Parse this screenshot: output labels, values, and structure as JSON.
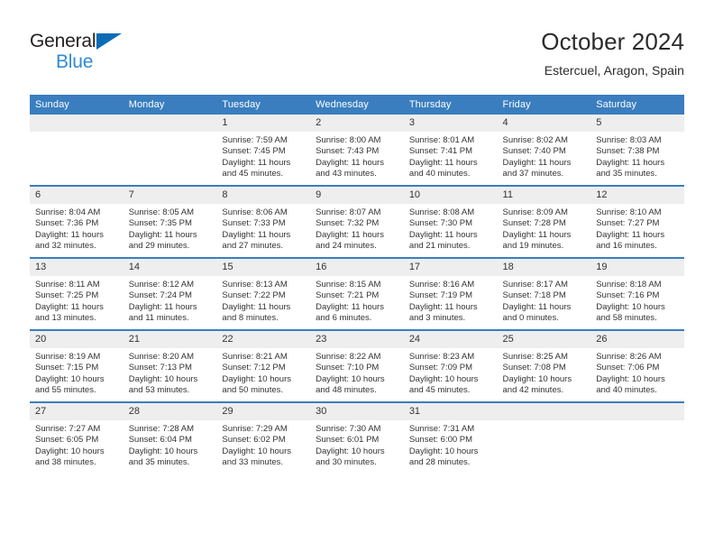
{
  "brand": {
    "name_top": "General",
    "name_bottom": "Blue",
    "triangle_color": "#0b6cb5",
    "text_color": "#231f20",
    "accent_color": "#2e8bd4"
  },
  "header": {
    "month_title": "October 2024",
    "location": "Estercuel, Aragon, Spain"
  },
  "theme": {
    "header_band": "#3a7ebf",
    "daynum_band": "#eeeeee",
    "text": "#333333"
  },
  "calendar": {
    "weekday_headers": [
      "Sunday",
      "Monday",
      "Tuesday",
      "Wednesday",
      "Thursday",
      "Friday",
      "Saturday"
    ],
    "weeks": [
      [
        {
          "day": "",
          "sunrise": "",
          "sunset": "",
          "daylight_line1": "",
          "daylight_line2": ""
        },
        {
          "day": "",
          "sunrise": "",
          "sunset": "",
          "daylight_line1": "",
          "daylight_line2": ""
        },
        {
          "day": "1",
          "sunrise": "Sunrise: 7:59 AM",
          "sunset": "Sunset: 7:45 PM",
          "daylight_line1": "Daylight: 11 hours",
          "daylight_line2": "and 45 minutes."
        },
        {
          "day": "2",
          "sunrise": "Sunrise: 8:00 AM",
          "sunset": "Sunset: 7:43 PM",
          "daylight_line1": "Daylight: 11 hours",
          "daylight_line2": "and 43 minutes."
        },
        {
          "day": "3",
          "sunrise": "Sunrise: 8:01 AM",
          "sunset": "Sunset: 7:41 PM",
          "daylight_line1": "Daylight: 11 hours",
          "daylight_line2": "and 40 minutes."
        },
        {
          "day": "4",
          "sunrise": "Sunrise: 8:02 AM",
          "sunset": "Sunset: 7:40 PM",
          "daylight_line1": "Daylight: 11 hours",
          "daylight_line2": "and 37 minutes."
        },
        {
          "day": "5",
          "sunrise": "Sunrise: 8:03 AM",
          "sunset": "Sunset: 7:38 PM",
          "daylight_line1": "Daylight: 11 hours",
          "daylight_line2": "and 35 minutes."
        }
      ],
      [
        {
          "day": "6",
          "sunrise": "Sunrise: 8:04 AM",
          "sunset": "Sunset: 7:36 PM",
          "daylight_line1": "Daylight: 11 hours",
          "daylight_line2": "and 32 minutes."
        },
        {
          "day": "7",
          "sunrise": "Sunrise: 8:05 AM",
          "sunset": "Sunset: 7:35 PM",
          "daylight_line1": "Daylight: 11 hours",
          "daylight_line2": "and 29 minutes."
        },
        {
          "day": "8",
          "sunrise": "Sunrise: 8:06 AM",
          "sunset": "Sunset: 7:33 PM",
          "daylight_line1": "Daylight: 11 hours",
          "daylight_line2": "and 27 minutes."
        },
        {
          "day": "9",
          "sunrise": "Sunrise: 8:07 AM",
          "sunset": "Sunset: 7:32 PM",
          "daylight_line1": "Daylight: 11 hours",
          "daylight_line2": "and 24 minutes."
        },
        {
          "day": "10",
          "sunrise": "Sunrise: 8:08 AM",
          "sunset": "Sunset: 7:30 PM",
          "daylight_line1": "Daylight: 11 hours",
          "daylight_line2": "and 21 minutes."
        },
        {
          "day": "11",
          "sunrise": "Sunrise: 8:09 AM",
          "sunset": "Sunset: 7:28 PM",
          "daylight_line1": "Daylight: 11 hours",
          "daylight_line2": "and 19 minutes."
        },
        {
          "day": "12",
          "sunrise": "Sunrise: 8:10 AM",
          "sunset": "Sunset: 7:27 PM",
          "daylight_line1": "Daylight: 11 hours",
          "daylight_line2": "and 16 minutes."
        }
      ],
      [
        {
          "day": "13",
          "sunrise": "Sunrise: 8:11 AM",
          "sunset": "Sunset: 7:25 PM",
          "daylight_line1": "Daylight: 11 hours",
          "daylight_line2": "and 13 minutes."
        },
        {
          "day": "14",
          "sunrise": "Sunrise: 8:12 AM",
          "sunset": "Sunset: 7:24 PM",
          "daylight_line1": "Daylight: 11 hours",
          "daylight_line2": "and 11 minutes."
        },
        {
          "day": "15",
          "sunrise": "Sunrise: 8:13 AM",
          "sunset": "Sunset: 7:22 PM",
          "daylight_line1": "Daylight: 11 hours",
          "daylight_line2": "and 8 minutes."
        },
        {
          "day": "16",
          "sunrise": "Sunrise: 8:15 AM",
          "sunset": "Sunset: 7:21 PM",
          "daylight_line1": "Daylight: 11 hours",
          "daylight_line2": "and 6 minutes."
        },
        {
          "day": "17",
          "sunrise": "Sunrise: 8:16 AM",
          "sunset": "Sunset: 7:19 PM",
          "daylight_line1": "Daylight: 11 hours",
          "daylight_line2": "and 3 minutes."
        },
        {
          "day": "18",
          "sunrise": "Sunrise: 8:17 AM",
          "sunset": "Sunset: 7:18 PM",
          "daylight_line1": "Daylight: 11 hours",
          "daylight_line2": "and 0 minutes."
        },
        {
          "day": "19",
          "sunrise": "Sunrise: 8:18 AM",
          "sunset": "Sunset: 7:16 PM",
          "daylight_line1": "Daylight: 10 hours",
          "daylight_line2": "and 58 minutes."
        }
      ],
      [
        {
          "day": "20",
          "sunrise": "Sunrise: 8:19 AM",
          "sunset": "Sunset: 7:15 PM",
          "daylight_line1": "Daylight: 10 hours",
          "daylight_line2": "and 55 minutes."
        },
        {
          "day": "21",
          "sunrise": "Sunrise: 8:20 AM",
          "sunset": "Sunset: 7:13 PM",
          "daylight_line1": "Daylight: 10 hours",
          "daylight_line2": "and 53 minutes."
        },
        {
          "day": "22",
          "sunrise": "Sunrise: 8:21 AM",
          "sunset": "Sunset: 7:12 PM",
          "daylight_line1": "Daylight: 10 hours",
          "daylight_line2": "and 50 minutes."
        },
        {
          "day": "23",
          "sunrise": "Sunrise: 8:22 AM",
          "sunset": "Sunset: 7:10 PM",
          "daylight_line1": "Daylight: 10 hours",
          "daylight_line2": "and 48 minutes."
        },
        {
          "day": "24",
          "sunrise": "Sunrise: 8:23 AM",
          "sunset": "Sunset: 7:09 PM",
          "daylight_line1": "Daylight: 10 hours",
          "daylight_line2": "and 45 minutes."
        },
        {
          "day": "25",
          "sunrise": "Sunrise: 8:25 AM",
          "sunset": "Sunset: 7:08 PM",
          "daylight_line1": "Daylight: 10 hours",
          "daylight_line2": "and 42 minutes."
        },
        {
          "day": "26",
          "sunrise": "Sunrise: 8:26 AM",
          "sunset": "Sunset: 7:06 PM",
          "daylight_line1": "Daylight: 10 hours",
          "daylight_line2": "and 40 minutes."
        }
      ],
      [
        {
          "day": "27",
          "sunrise": "Sunrise: 7:27 AM",
          "sunset": "Sunset: 6:05 PM",
          "daylight_line1": "Daylight: 10 hours",
          "daylight_line2": "and 38 minutes."
        },
        {
          "day": "28",
          "sunrise": "Sunrise: 7:28 AM",
          "sunset": "Sunset: 6:04 PM",
          "daylight_line1": "Daylight: 10 hours",
          "daylight_line2": "and 35 minutes."
        },
        {
          "day": "29",
          "sunrise": "Sunrise: 7:29 AM",
          "sunset": "Sunset: 6:02 PM",
          "daylight_line1": "Daylight: 10 hours",
          "daylight_line2": "and 33 minutes."
        },
        {
          "day": "30",
          "sunrise": "Sunrise: 7:30 AM",
          "sunset": "Sunset: 6:01 PM",
          "daylight_line1": "Daylight: 10 hours",
          "daylight_line2": "and 30 minutes."
        },
        {
          "day": "31",
          "sunrise": "Sunrise: 7:31 AM",
          "sunset": "Sunset: 6:00 PM",
          "daylight_line1": "Daylight: 10 hours",
          "daylight_line2": "and 28 minutes."
        },
        {
          "day": "",
          "sunrise": "",
          "sunset": "",
          "daylight_line1": "",
          "daylight_line2": ""
        },
        {
          "day": "",
          "sunrise": "",
          "sunset": "",
          "daylight_line1": "",
          "daylight_line2": ""
        }
      ]
    ]
  }
}
